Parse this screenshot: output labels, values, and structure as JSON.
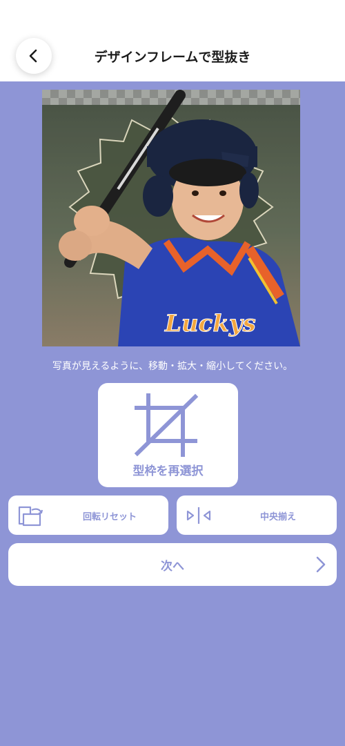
{
  "header": {
    "title": "デザインフレームで型抜き",
    "back_icon": "chevron-left-icon"
  },
  "photo": {
    "description_icon": "boy-batter-photo",
    "jersey_text": "Luckys"
  },
  "instruction": "写真が見えるように、移動・拡大・縮小してください。",
  "buttons": {
    "reselect_label": "型枠を再選択",
    "reset_rotation_label": "回転リセット",
    "center_align_label": "中央揃え",
    "next_label": "次へ"
  },
  "colors": {
    "background": "#8e95d6",
    "accent": "#8e95d6",
    "header": "#ffffff"
  }
}
